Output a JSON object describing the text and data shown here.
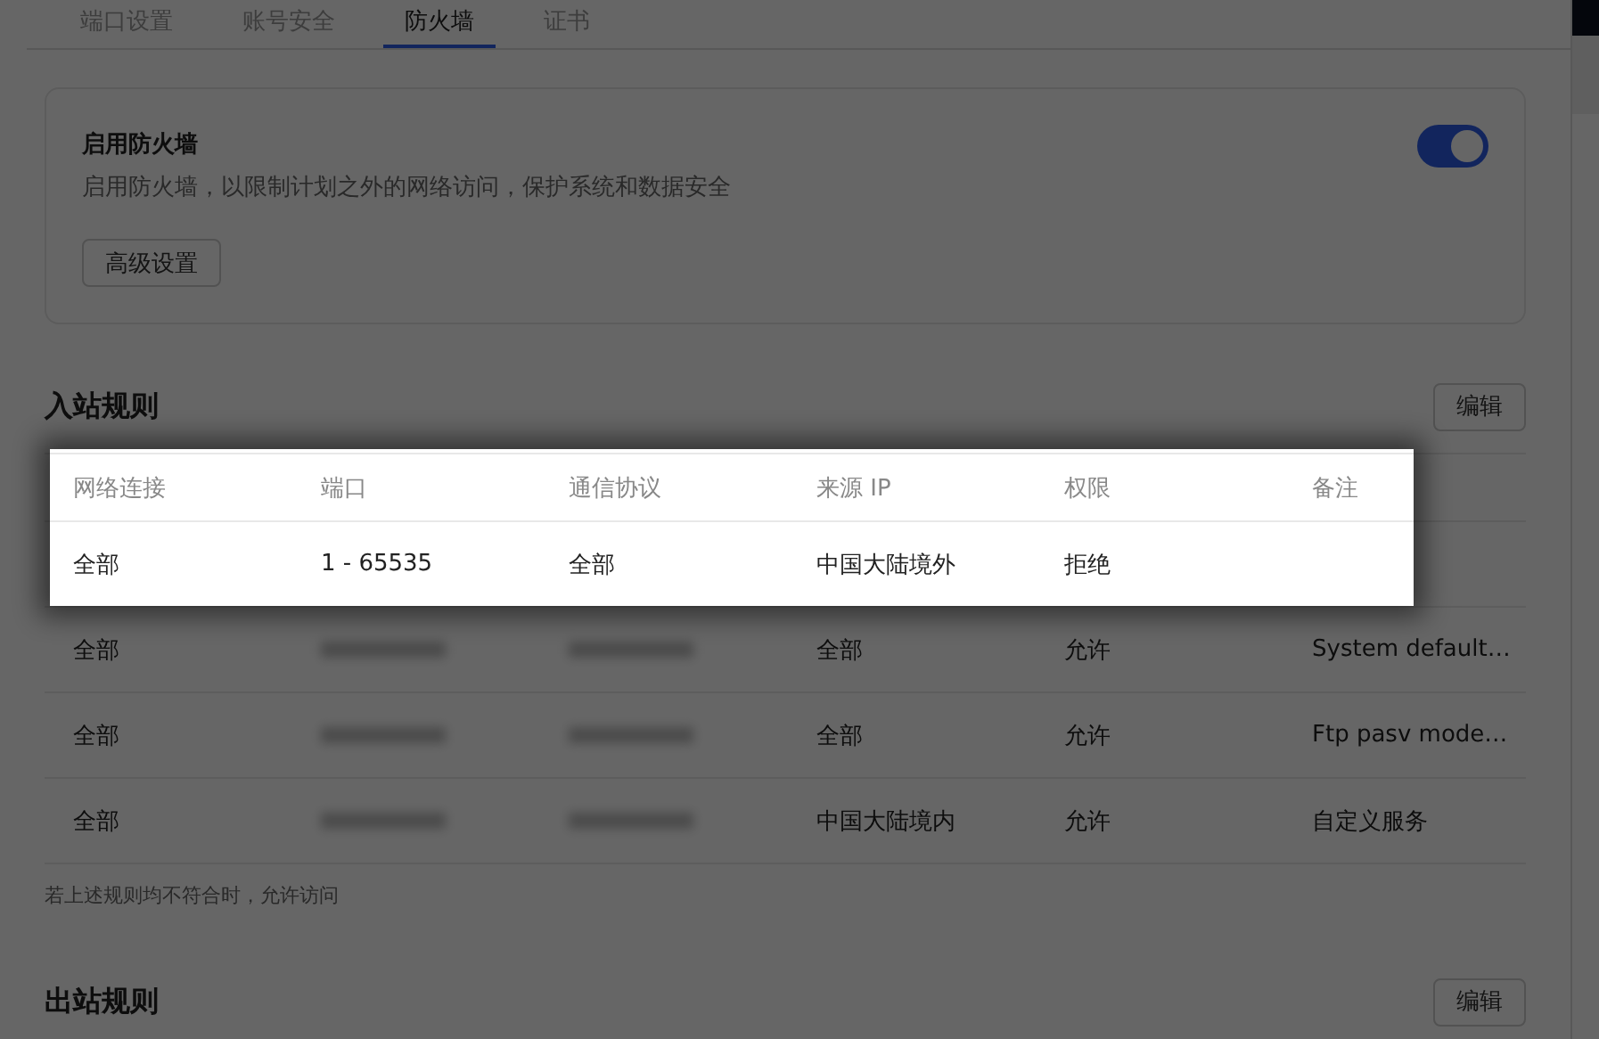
{
  "tabs": [
    {
      "label": "端口设置",
      "selected": false
    },
    {
      "label": "账号安全",
      "selected": false
    },
    {
      "label": "防火墙",
      "selected": true
    },
    {
      "label": "证书",
      "selected": false
    }
  ],
  "firewall": {
    "title": "启用防火墙",
    "description": "启用防火墙，以限制计划之外的网络访问，保护系统和数据安全",
    "on": true,
    "button": "高级设置"
  },
  "inbound": {
    "title": "入站规则",
    "edit": "编辑",
    "columns": [
      "网络连接",
      "端口",
      "通信协议",
      "来源 IP",
      "权限",
      "备注"
    ],
    "rows": [
      {
        "highlighted": true,
        "cells": [
          "全部",
          "1 - 65535",
          "全部",
          "中国大陆境外",
          "拒绝"
        ]
      },
      {
        "highlighted": false,
        "cells": [
          "全部",
          {
            "kind": "redacted"
          },
          {
            "kind": "redacted"
          },
          "全部",
          "允许",
          "System default…"
        ]
      },
      {
        "highlighted": false,
        "cells": [
          "全部",
          {
            "kind": "redacted"
          },
          {
            "kind": "redacted"
          },
          "全部",
          "允许",
          "Ftp pasv mode…"
        ]
      },
      {
        "highlighted": false,
        "cells": [
          "全部",
          {
            "kind": "redacted"
          },
          {
            "kind": "redacted"
          },
          "中国大陆境内",
          "允许",
          "自定义服务"
        ]
      }
    ],
    "note": "若上述规则均不符合时，允许访问"
  },
  "outbound": {
    "title": "出站规则",
    "edit": "编辑"
  }
}
